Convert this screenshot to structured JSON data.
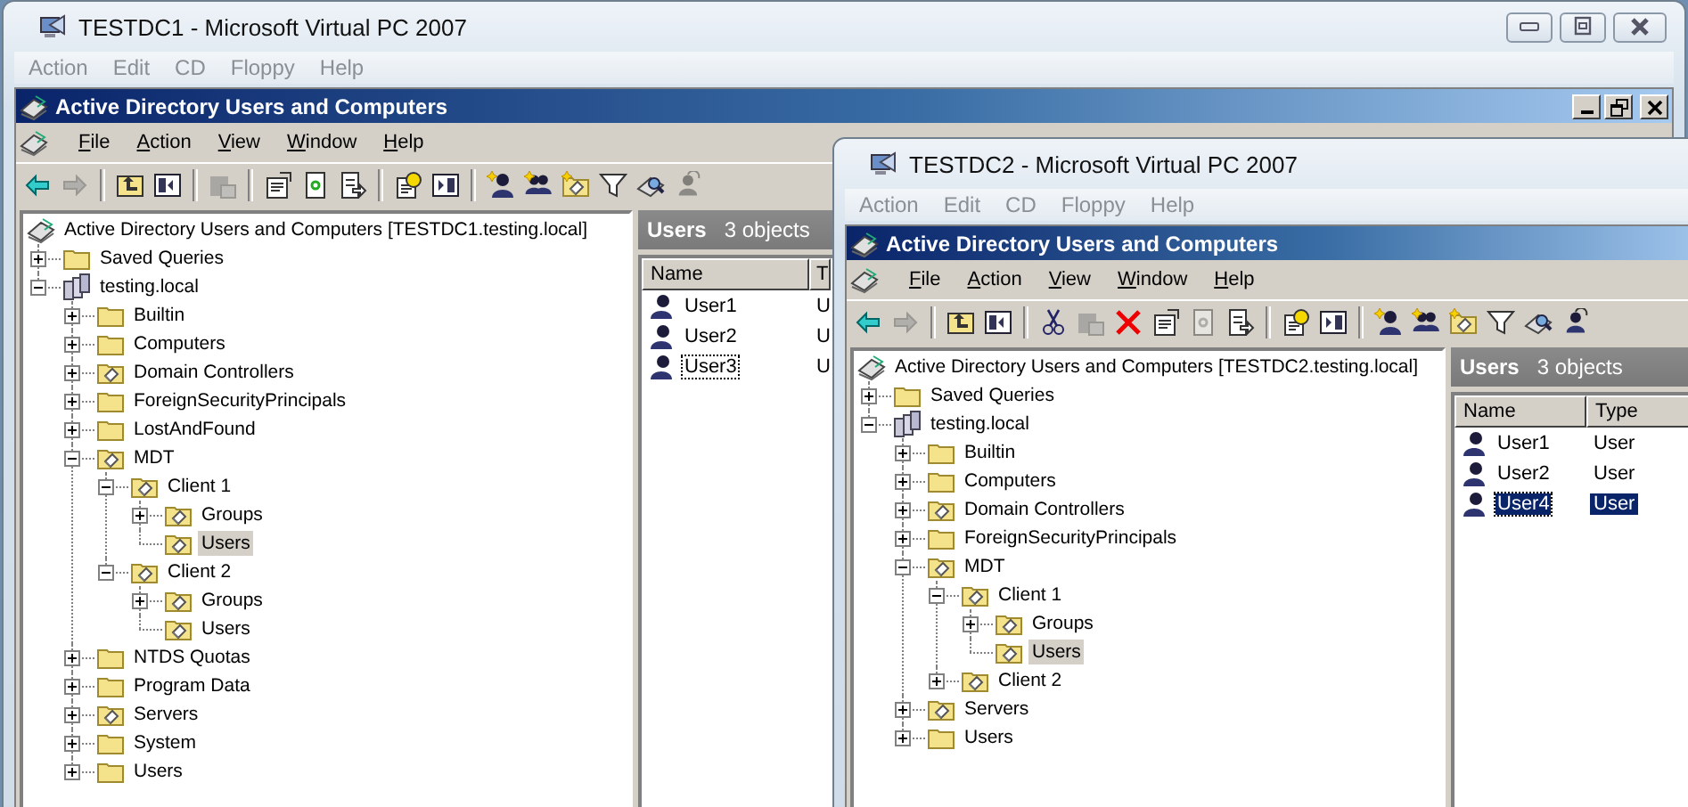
{
  "windows": [
    {
      "title": "TESTDC1 - Microsoft Virtual PC 2007",
      "controls": [
        {
          "kind": "minimize"
        },
        {
          "kind": "maximize"
        },
        {
          "kind": "close"
        }
      ],
      "menu": [
        "Action",
        "Edit",
        "CD",
        "Floppy",
        "Help"
      ],
      "mmc": {
        "title": "Active Directory Users and Computers",
        "controls": [
          {
            "kind": "minimize"
          },
          {
            "kind": "restore"
          },
          {
            "kind": "close"
          }
        ],
        "menu": [
          "File",
          "Action",
          "View",
          "Window",
          "Help"
        ],
        "toolbar": [
          {
            "kind": "back",
            "disabled": false
          },
          {
            "kind": "forward",
            "disabled": true
          },
          {
            "kind": "separator"
          },
          {
            "kind": "up",
            "disabled": false
          },
          {
            "kind": "tree",
            "disabled": false
          },
          {
            "kind": "separator"
          },
          {
            "kind": "paste",
            "disabled": true
          },
          {
            "kind": "separator"
          },
          {
            "kind": "properties",
            "disabled": false
          },
          {
            "kind": "refresh",
            "disabled": false
          },
          {
            "kind": "export",
            "disabled": false
          },
          {
            "kind": "separator"
          },
          {
            "kind": "help",
            "disabled": false
          },
          {
            "kind": "pane",
            "disabled": false
          },
          {
            "kind": "separator"
          },
          {
            "kind": "newuser",
            "disabled": false
          },
          {
            "kind": "newgroup",
            "disabled": false
          },
          {
            "kind": "newou",
            "disabled": false
          },
          {
            "kind": "filter",
            "disabled": false
          },
          {
            "kind": "find",
            "disabled": false
          },
          {
            "kind": "addgroup",
            "disabled": true
          }
        ],
        "tree": [
          {
            "label": "Active Directory Users and Computers [TESTDC1.testing.local]",
            "kind": "root",
            "selected": false,
            "children": [
              {
                "label": "Saved Queries",
                "kind": "folder",
                "selected": false,
                "expanded": false
              },
              {
                "label": "testing.local",
                "kind": "domain",
                "selected": false,
                "expanded": true,
                "children": [
                  {
                    "label": "Builtin",
                    "kind": "folder",
                    "selected": false,
                    "expanded": false
                  },
                  {
                    "label": "Computers",
                    "kind": "folder",
                    "selected": false,
                    "expanded": false
                  },
                  {
                    "label": "Domain Controllers",
                    "kind": "ou",
                    "selected": false,
                    "expanded": false
                  },
                  {
                    "label": "ForeignSecurityPrincipals",
                    "kind": "folder",
                    "selected": false,
                    "expanded": false
                  },
                  {
                    "label": "LostAndFound",
                    "kind": "folder",
                    "selected": false,
                    "expanded": false
                  },
                  {
                    "label": "MDT",
                    "kind": "ou",
                    "selected": false,
                    "expanded": true,
                    "children": [
                      {
                        "label": "Client 1",
                        "kind": "ou",
                        "selected": false,
                        "expanded": true,
                        "children": [
                          {
                            "label": "Groups",
                            "kind": "ou",
                            "selected": false,
                            "expanded": false
                          },
                          {
                            "label": "Users",
                            "kind": "ou",
                            "selected": true
                          }
                        ]
                      },
                      {
                        "label": "Client 2",
                        "kind": "ou",
                        "selected": false,
                        "expanded": true,
                        "children": [
                          {
                            "label": "Groups",
                            "kind": "ou",
                            "selected": false,
                            "expanded": false
                          },
                          {
                            "label": "Users",
                            "kind": "ou",
                            "selected": false
                          }
                        ]
                      }
                    ]
                  },
                  {
                    "label": "NTDS Quotas",
                    "kind": "folder",
                    "selected": false,
                    "expanded": false
                  },
                  {
                    "label": "Program Data",
                    "kind": "folder",
                    "selected": false,
                    "expanded": false
                  },
                  {
                    "label": "Servers",
                    "kind": "ou",
                    "selected": false,
                    "expanded": false
                  },
                  {
                    "label": "System",
                    "kind": "folder",
                    "selected": false,
                    "expanded": false
                  },
                  {
                    "label": "Users",
                    "kind": "folder",
                    "selected": false,
                    "expanded": false
                  }
                ]
              }
            ]
          }
        ],
        "list": {
          "heading": "Users",
          "count": "3 objects",
          "columns": [
            "Name",
            "T"
          ],
          "rows": [
            {
              "cells": [
                "User1",
                "U"
              ],
              "selected": false,
              "focused": false
            },
            {
              "cells": [
                "User2",
                "U"
              ],
              "selected": false,
              "focused": false
            },
            {
              "cells": [
                "User3",
                "U"
              ],
              "selected": false,
              "focused": true
            }
          ]
        }
      }
    },
    {
      "title": "TESTDC2 - Microsoft Virtual PC 2007",
      "menu": [
        "Action",
        "Edit",
        "CD",
        "Floppy",
        "Help"
      ],
      "mmc": {
        "title": "Active Directory Users and Computers",
        "menu": [
          "File",
          "Action",
          "View",
          "Window",
          "Help"
        ],
        "toolbar": [
          {
            "kind": "back",
            "disabled": false
          },
          {
            "kind": "forward",
            "disabled": true
          },
          {
            "kind": "separator"
          },
          {
            "kind": "up",
            "disabled": false
          },
          {
            "kind": "tree",
            "disabled": false
          },
          {
            "kind": "separator"
          },
          {
            "kind": "cut",
            "disabled": false
          },
          {
            "kind": "paste",
            "disabled": true
          },
          {
            "kind": "delete",
            "disabled": false
          },
          {
            "kind": "properties",
            "disabled": false
          },
          {
            "kind": "refresh",
            "disabled": true
          },
          {
            "kind": "export",
            "disabled": false
          },
          {
            "kind": "separator"
          },
          {
            "kind": "help",
            "disabled": false
          },
          {
            "kind": "pane",
            "disabled": false
          },
          {
            "kind": "separator"
          },
          {
            "kind": "newuser",
            "disabled": false
          },
          {
            "kind": "newgroup",
            "disabled": false
          },
          {
            "kind": "newou",
            "disabled": false
          },
          {
            "kind": "filter",
            "disabled": false
          },
          {
            "kind": "find",
            "disabled": false
          },
          {
            "kind": "addgroup",
            "disabled": false
          }
        ],
        "tree": [
          {
            "label": "Active Directory Users and Computers [TESTDC2.testing.local]",
            "kind": "root",
            "selected": false,
            "children": [
              {
                "label": "Saved Queries",
                "kind": "folder",
                "selected": false,
                "expanded": false
              },
              {
                "label": "testing.local",
                "kind": "domain",
                "selected": false,
                "expanded": true,
                "children": [
                  {
                    "label": "Builtin",
                    "kind": "folder",
                    "selected": false,
                    "expanded": false
                  },
                  {
                    "label": "Computers",
                    "kind": "folder",
                    "selected": false,
                    "expanded": false
                  },
                  {
                    "label": "Domain Controllers",
                    "kind": "ou",
                    "selected": false,
                    "expanded": false
                  },
                  {
                    "label": "ForeignSecurityPrincipals",
                    "kind": "folder",
                    "selected": false,
                    "expanded": false
                  },
                  {
                    "label": "MDT",
                    "kind": "ou",
                    "selected": false,
                    "expanded": true,
                    "children": [
                      {
                        "label": "Client 1",
                        "kind": "ou",
                        "selected": false,
                        "expanded": true,
                        "children": [
                          {
                            "label": "Groups",
                            "kind": "ou",
                            "selected": false,
                            "expanded": false
                          },
                          {
                            "label": "Users",
                            "kind": "ou",
                            "selected": true
                          }
                        ]
                      },
                      {
                        "label": "Client 2",
                        "kind": "ou",
                        "selected": false,
                        "expanded": false
                      }
                    ]
                  },
                  {
                    "label": "Servers",
                    "kind": "ou",
                    "selected": false,
                    "expanded": false
                  },
                  {
                    "label": "Users",
                    "kind": "folder",
                    "selected": false,
                    "expanded": false
                  }
                ]
              }
            ]
          }
        ],
        "list": {
          "heading": "Users",
          "count": "3 objects",
          "columns": [
            "Name",
            "Type"
          ],
          "rows": [
            {
              "cells": [
                "User1",
                "User"
              ],
              "selected": false,
              "focused": false
            },
            {
              "cells": [
                "User2",
                "User"
              ],
              "selected": false,
              "focused": false
            },
            {
              "cells": [
                "User4",
                "User"
              ],
              "selected": true,
              "focused": true
            }
          ]
        }
      }
    }
  ]
}
